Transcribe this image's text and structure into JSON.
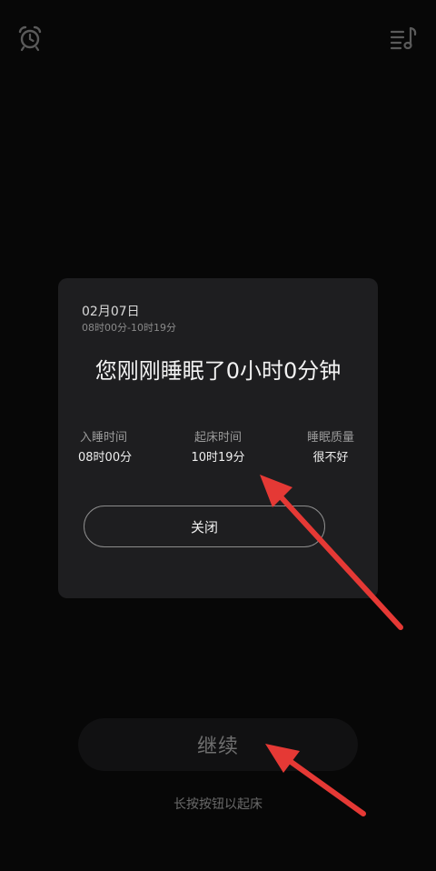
{
  "top_bar": {
    "left_icon": "alarm-clock-icon",
    "right_icon": "music-playlist-icon"
  },
  "card": {
    "date": "02月07日",
    "time_range": "08时00分-10时19分",
    "headline": "您刚刚睡眠了0小时0分钟",
    "stats": [
      {
        "label": "入睡时间",
        "value": "08时00分"
      },
      {
        "label": "起床时间",
        "value": "10时19分"
      },
      {
        "label": "睡眠质量",
        "value": "很不好"
      }
    ],
    "close_label": "关闭"
  },
  "continue_label": "继续",
  "hint": "长按按钮以起床",
  "colors": {
    "background": "#070707",
    "card": "#1e1e20",
    "annotation_arrow": "#e53935"
  }
}
